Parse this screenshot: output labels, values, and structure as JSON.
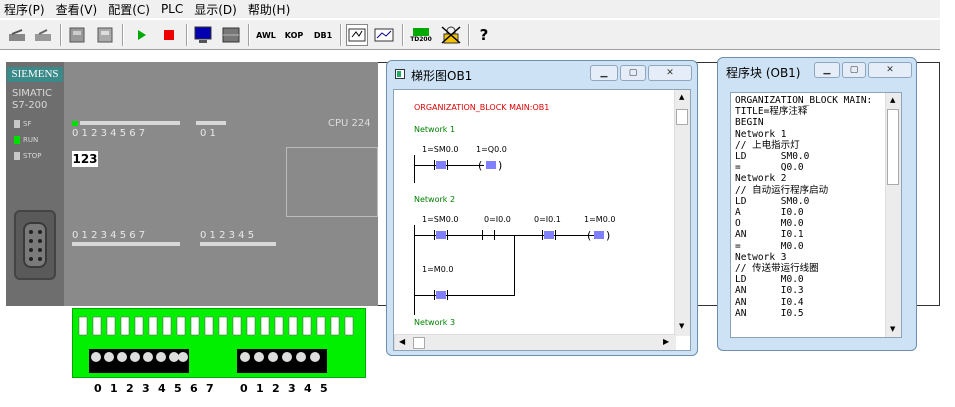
{
  "menu": [
    "程序(P)",
    "查看(V)",
    "配置(C)",
    "PLC",
    "显示(D)",
    "帮助(H)"
  ],
  "toolbar": {
    "awl": "AWL",
    "kop": "KOP",
    "db1": "DB1",
    "td": "TD200",
    "help": "?"
  },
  "plc": {
    "brand": "SIEMENS",
    "simatic": "SIMATIC",
    "model": "S7-200",
    "leds": [
      "SF",
      "RUN",
      "STOP"
    ],
    "cpu": "CPU 224",
    "display": "123",
    "out_top_nums": "0 1 2 3 4 5 6 7",
    "out_top_nums2": "0 1",
    "in_nums": "0 1 2 3 4 5 6 7",
    "in_nums2": "0 1 2 3 4 5"
  },
  "switch_labels": [
    "0",
    "1",
    "2",
    "3",
    "4",
    "5",
    "6",
    "7",
    "0",
    "1",
    "2",
    "3",
    "4",
    "5"
  ],
  "ladder_window": {
    "title": "梯形图OB1",
    "block": "ORGANIZATION_BLOCK MAIN:OB1",
    "networks": [
      "Network 1",
      "Network 2",
      "Network 3"
    ],
    "n1": [
      "1=SM0.0",
      "1=Q0.0"
    ],
    "n2": [
      "1=SM0.0",
      "0=I0.0",
      "0=I0.1",
      "1=M0.0"
    ],
    "n2b": "1=M0.0"
  },
  "stl_window": {
    "title": "程序块 (OB1)",
    "lines": [
      "ORGANIZATION_BLOCK MAIN:",
      "TITLE=程序注释",
      "BEGIN",
      "Network 1",
      "// 上电指示灯",
      "LD      SM0.0",
      "=       Q0.0",
      "Network 2",
      "// 自动运行程序启动",
      "LD      SM0.0",
      "A       I0.0",
      "O       M0.0",
      "AN      I0.1",
      "=       M0.0",
      "Network 3",
      "// 传送带运行线圈",
      "LD      M0.0",
      "AN      I0.3",
      "AN      I0.4",
      "AN      I0.5"
    ]
  },
  "colors": {
    "red": "#e00000",
    "green": "#008000",
    "switch_green": "#00f000"
  }
}
